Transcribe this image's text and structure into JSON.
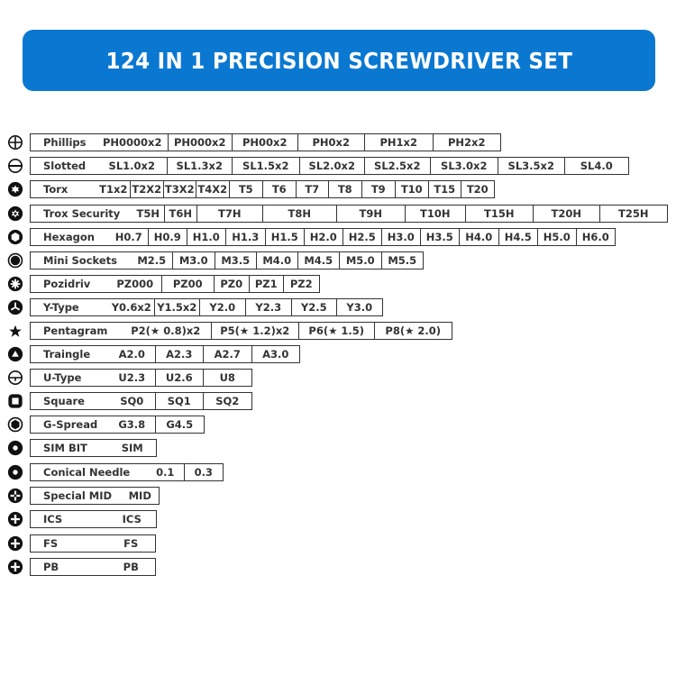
{
  "title": "124 IN 1 PRECISION SCREWDRIVER SET",
  "colors": {
    "banner": "#0a78d1",
    "text": "#333333"
  },
  "rows": [
    {
      "icon": "phillips-icon",
      "name": "Phillips",
      "sizes": [
        "PH0000x2",
        "PH000x2",
        "PH00x2",
        "PH0x2",
        "PH1x2",
        "PH2x2"
      ]
    },
    {
      "icon": "slotted-icon",
      "name": "Slotted",
      "sizes": [
        "SL1.0x2",
        "SL1.3x2",
        "SL1.5x2",
        "SL2.0x2",
        "SL2.5x2",
        "SL3.0x2",
        "SL3.5x2",
        "SL4.0"
      ]
    },
    {
      "icon": "torx-icon",
      "name": "Torx",
      "sizes": [
        "T1x2",
        "T2X2",
        "T3X2",
        "T4X2",
        "T5",
        "T6",
        "T7",
        "T8",
        "T9",
        "T10",
        "T15",
        "T20"
      ]
    },
    {
      "icon": "torx-security-icon",
      "name": "Trox Security",
      "sizes": [
        "T5H",
        "T6H",
        "T7H",
        "T8H",
        "T9H",
        "T10H",
        "T15H",
        "T20H",
        "T25H"
      ]
    },
    {
      "icon": "hexagon-icon",
      "name": "Hexagon",
      "sizes": [
        "H0.7",
        "H0.9",
        "H1.0",
        "H1.3",
        "H1.5",
        "H2.0",
        "H2.5",
        "H3.0",
        "H3.5",
        "H4.0",
        "H4.5",
        "H5.0",
        "H6.0"
      ]
    },
    {
      "icon": "mini-socket-icon",
      "name": "Mini Sockets",
      "sizes": [
        "M2.5",
        "M3.0",
        "M3.5",
        "M4.0",
        "M4.5",
        "M5.0",
        "M5.5"
      ]
    },
    {
      "icon": "pozidriv-icon",
      "name": "Pozidriv",
      "sizes": [
        "PZ000",
        "PZ00",
        "PZ0",
        "PZ1",
        "PZ2"
      ]
    },
    {
      "icon": "y-type-icon",
      "name": "Y-Type",
      "sizes": [
        "Y0.6x2",
        "Y1.5x2",
        "Y2.0",
        "Y2.3",
        "Y2.5",
        "Y3.0"
      ]
    },
    {
      "icon": "pentagram-icon",
      "name": "Pentagram",
      "sizes": [
        "P2(★ 0.8)x2",
        "P5(★ 1.2)x2",
        "P6(★ 1.5)",
        "P8(★ 2.0)"
      ]
    },
    {
      "icon": "triangle-icon",
      "name": "Traingle",
      "sizes": [
        "A2.0",
        "A2.3",
        "A2.7",
        "A3.0"
      ]
    },
    {
      "icon": "u-type-icon",
      "name": "U-Type",
      "sizes": [
        "U2.3",
        "U2.6",
        "U8"
      ]
    },
    {
      "icon": "square-icon",
      "name": "Square",
      "sizes": [
        "SQ0",
        "SQ1",
        "SQ2"
      ]
    },
    {
      "icon": "g-spread-icon",
      "name": "G-Spread",
      "sizes": [
        "G3.8",
        "G4.5"
      ]
    },
    {
      "icon": "sim-bit-icon",
      "name": "SIM BIT",
      "sizes": [
        "SIM"
      ]
    },
    {
      "icon": "conical-needle-icon",
      "name": "Conical Needle",
      "sizes": [
        "0.1",
        "0.3"
      ]
    },
    {
      "icon": "special-mid-icon",
      "name": "Special MID",
      "sizes": [
        "MID"
      ]
    },
    {
      "icon": "ics-icon",
      "name": "ICS",
      "sizes": [
        "ICS"
      ]
    },
    {
      "icon": "fs-icon",
      "name": "FS",
      "sizes": [
        "FS"
      ]
    },
    {
      "icon": "pb-icon",
      "name": "PB",
      "sizes": [
        "PB"
      ]
    }
  ]
}
